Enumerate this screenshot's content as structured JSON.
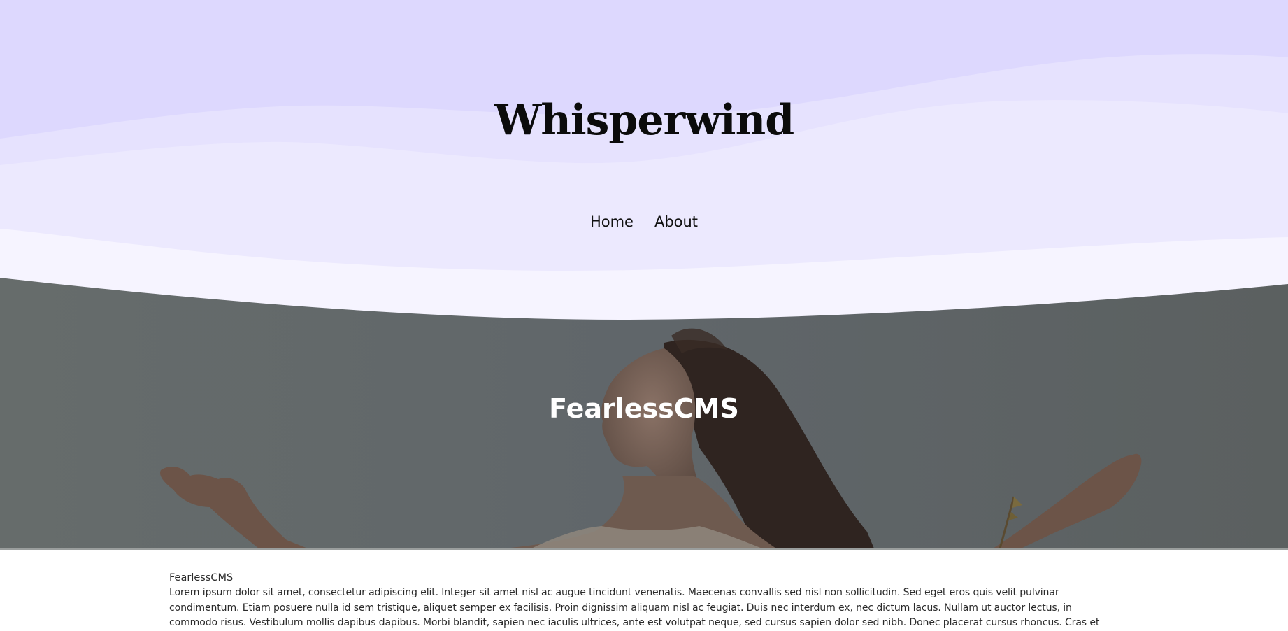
{
  "header": {
    "site_title": "Whisperwind",
    "nav": [
      {
        "label": "Home"
      },
      {
        "label": "About"
      }
    ],
    "colors": {
      "wave_top": "#ddd8fe",
      "wave_mid": "#e6e2fe",
      "wave_light": "#ece9fe",
      "wave_lightest": "#f6f4ff"
    }
  },
  "hero": {
    "title": "FearlessCMS",
    "image_subject": "woman with arms outstretched, eyes closed, hair blowing in the wind"
  },
  "content": {
    "title": "FearlessCMS",
    "body": "Lorem ipsum dolor sit amet, consectetur adipiscing elit. Integer sit amet nisl ac augue tincidunt venenatis. Maecenas convallis sed nisl non sollicitudin. Sed eget eros quis velit pulvinar condimentum. Etiam posuere nulla id sem tristique, aliquet semper ex facilisis. Proin dignissim aliquam nisl ac feugiat. Duis nec interdum ex, nec dictum lacus. Nullam ut auctor lectus, in commodo risus. Vestibulum mollis dapibus dapibus. Morbi blandit, sapien nec iaculis ultrices, ante est volutpat neque, sed cursus sapien dolor sed nibh. Donec placerat cursus rhoncus. Cras et lectus congue libero molestie"
  }
}
